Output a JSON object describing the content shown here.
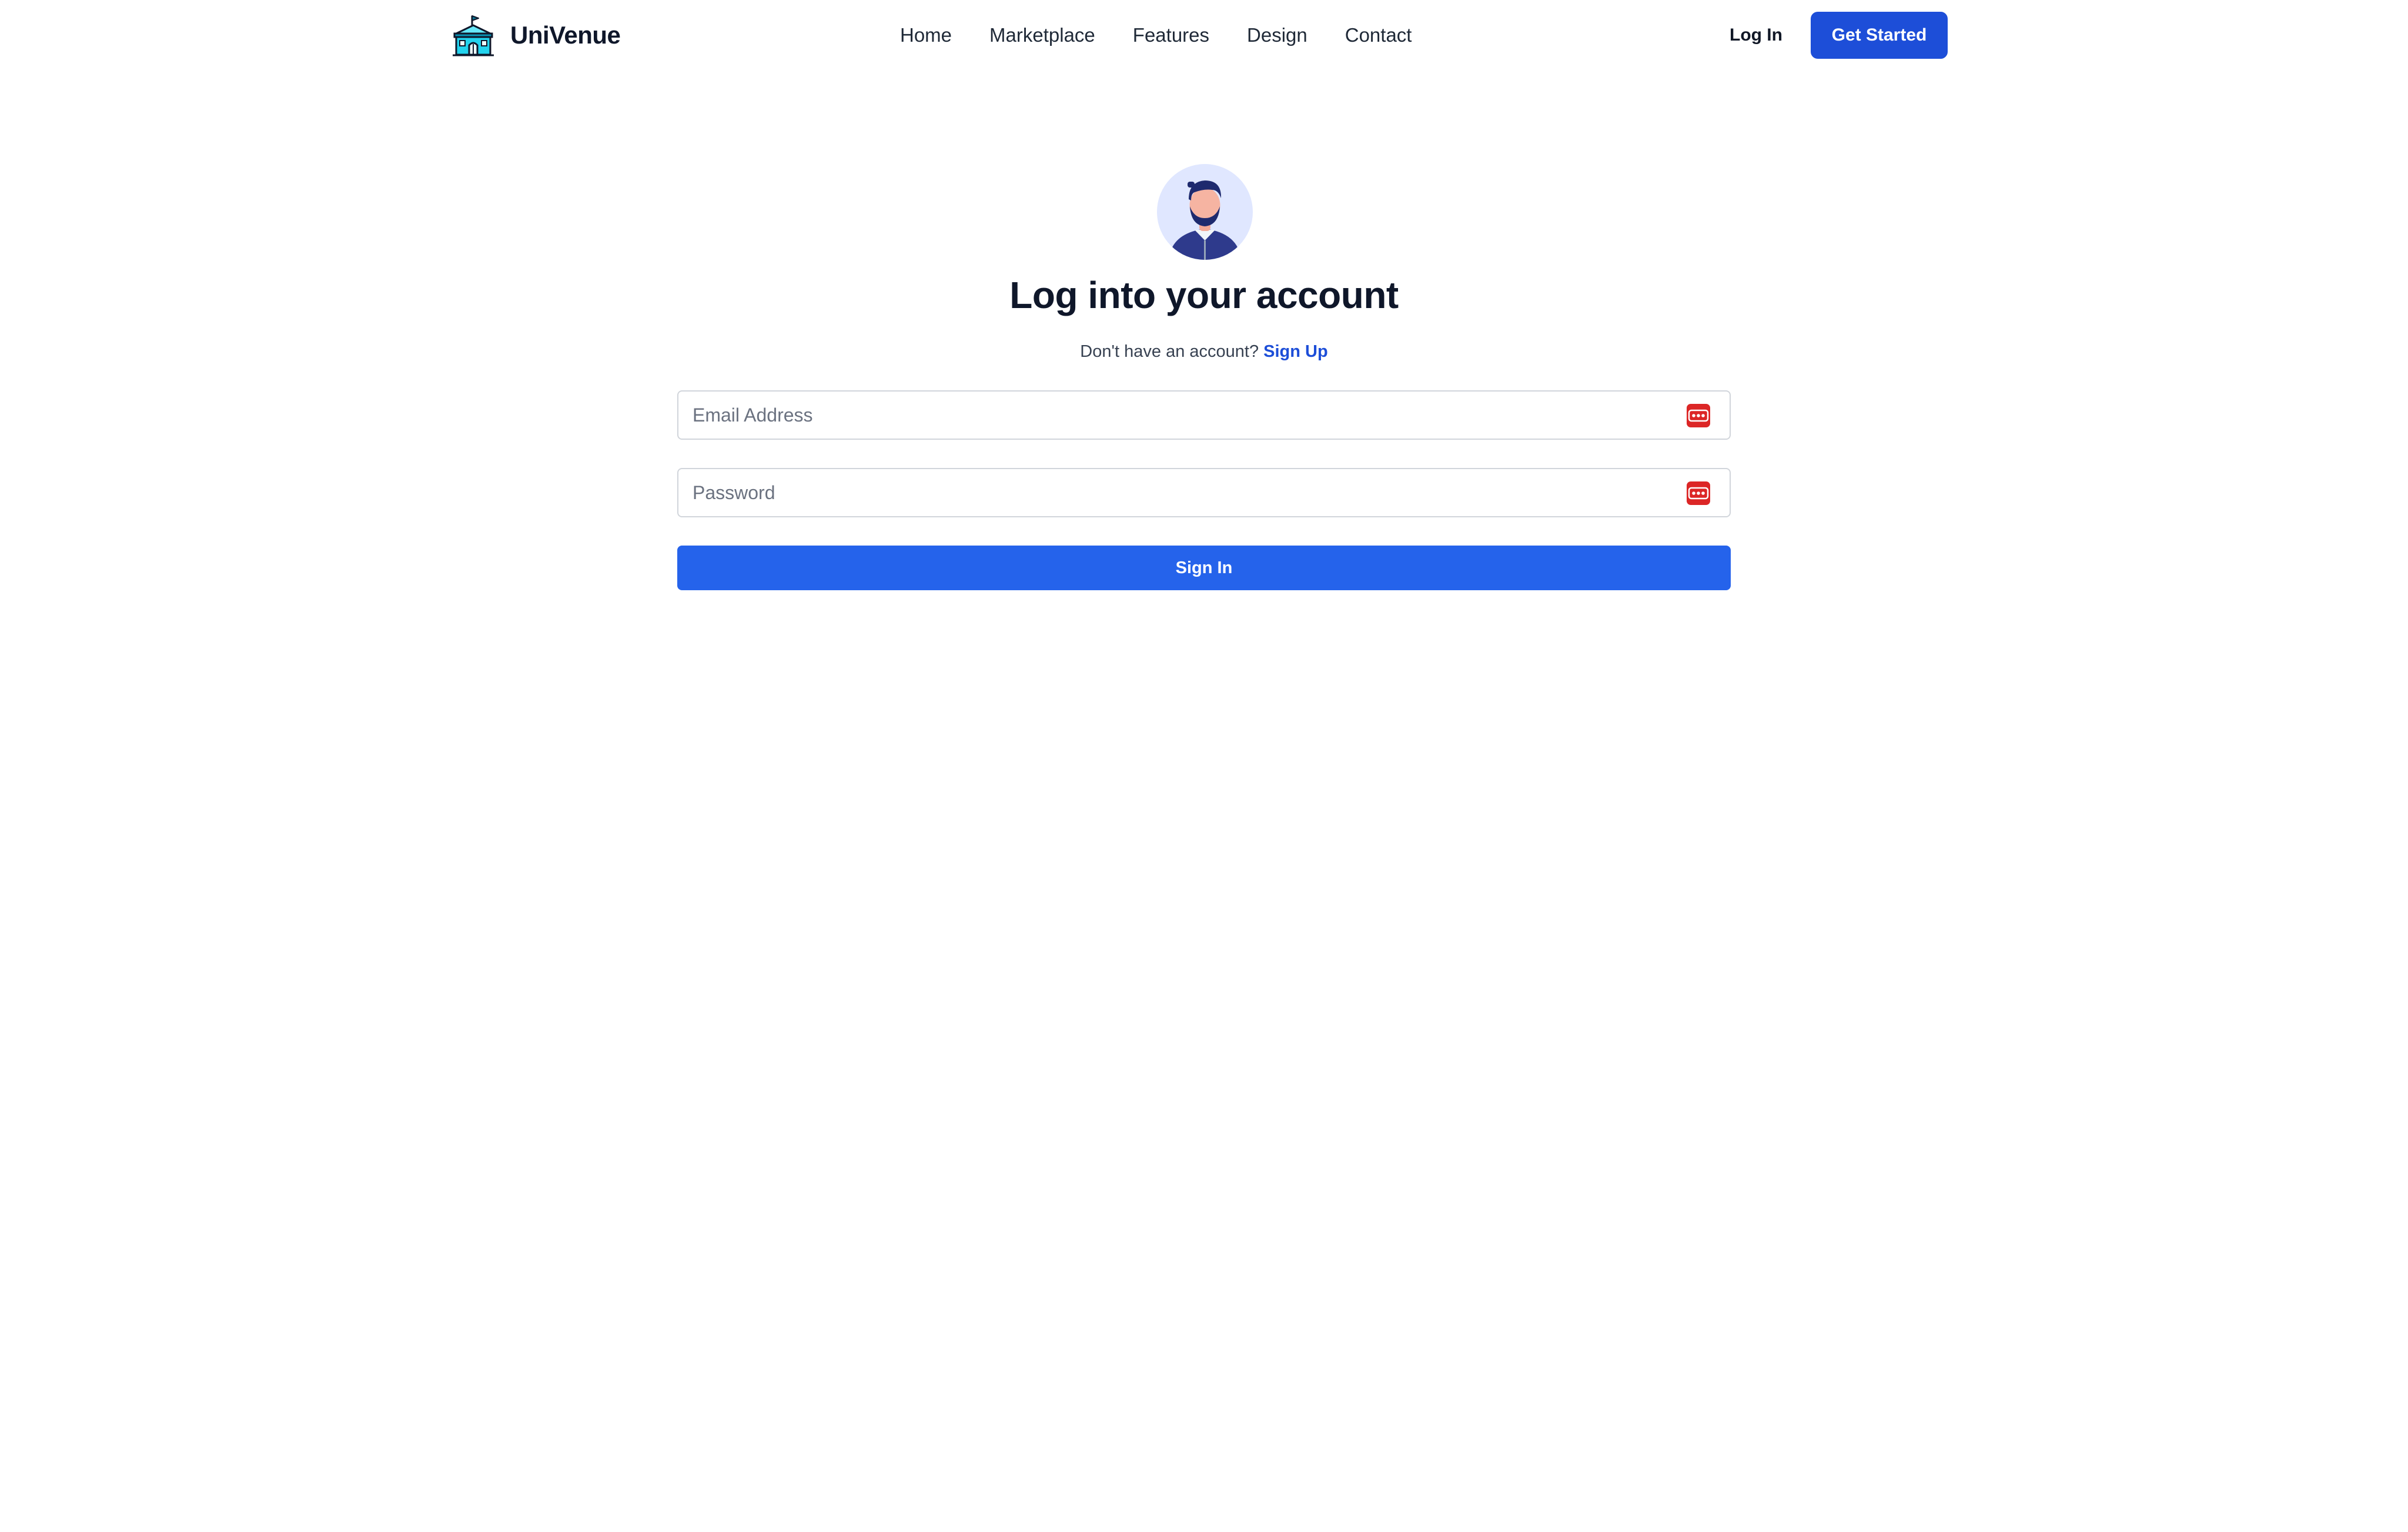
{
  "header": {
    "brand_name": "UniVenue",
    "brand_icon": "university-building-icon",
    "nav": [
      {
        "label": "Home"
      },
      {
        "label": "Marketplace"
      },
      {
        "label": "Features"
      },
      {
        "label": "Design"
      },
      {
        "label": "Contact"
      }
    ],
    "login_label": "Log In",
    "cta_label": "Get Started"
  },
  "login": {
    "avatar_icon": "user-avatar-illustration",
    "title": "Log into your account",
    "signup_prompt": "Don't have an account?",
    "signup_link": "Sign Up",
    "email_placeholder": "Email Address",
    "password_placeholder": "Password",
    "field_icon": "password-manager-icon",
    "submit_label": "Sign In"
  },
  "colors": {
    "primary": "#2563eb",
    "cta": "#1d4ed8",
    "link": "#1d4ed8",
    "field_icon": "#dc2626",
    "avatar_bg": "#e0e7ff",
    "text_dark": "#0f172a"
  }
}
